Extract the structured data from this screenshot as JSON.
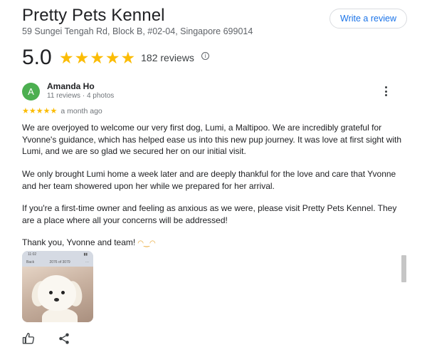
{
  "business": {
    "name": "Pretty Pets Kennel",
    "address": "59 Sungei Tengah Rd, Block B, #02-04, Singapore 699014",
    "write_review_label": "Write a review"
  },
  "summary": {
    "rating": "5.0",
    "stars": 5,
    "review_count": "182 reviews",
    "star_color": "#fbbc04"
  },
  "review": {
    "avatar_initial": "A",
    "avatar_color": "#4caf50",
    "reviewer_name": "Amanda Ho",
    "reviewer_meta": "11 reviews · 4 photos",
    "stars": 5,
    "time": "a month ago",
    "paragraphs": [
      "We are overjoyed to welcome our very first dog, Lumi, a Maltipoo. We are incredibly grateful for Yvonne's guidance, which has helped ease us into this new pup journey. It was love at first sight with Lumi, and we are so glad we secured her on our initial visit.",
      "We only brought Lumi home a week later and are deeply thankful for the love and care that Yvonne and her team showered upon her while we prepared for her arrival.",
      "If you're a first-time owner and feeling as anxious as we were, please visit Pretty Pets Kennel. They are a place where all your concerns will be addressed!",
      "Thank you, Yvonne and team!"
    ],
    "photo_status_time": "11:02",
    "photo_counter": "2076 of 3079",
    "photo_back_label": "Back"
  },
  "icons": [
    "star-icon",
    "info-icon",
    "more-vert-icon",
    "thumbs-up-icon",
    "share-icon",
    "smiling-emoji-icon"
  ]
}
